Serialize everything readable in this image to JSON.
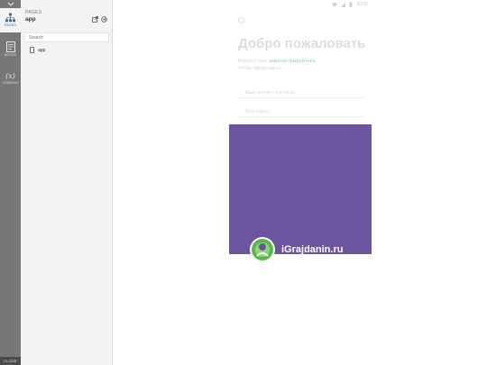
{
  "rail": {
    "items": [
      {
        "label": "PAGES",
        "icon": "sitemap-icon",
        "active": true
      },
      {
        "label": "NOTES",
        "icon": "notes-icon",
        "active": false
      },
      {
        "label": "CONSOLE",
        "icon": "variable-icon",
        "glyph": "(x)",
        "active": false
      }
    ],
    "close_label": "CLOSE"
  },
  "panel": {
    "caption": "PAGES",
    "project": "app",
    "search_placeholder": "Search",
    "pages": [
      {
        "label": "app",
        "icon": "phone-icon"
      }
    ]
  },
  "device": {
    "status_time": "20:01",
    "welcome_title": "Добро пожаловать",
    "subtitle_prefix": "Войдите или",
    "subtitle_link": "зарегистрируйтесь",
    "subtitle_suffix": "чтобы продолжить",
    "field_1_placeholder": "Ваш телефон или email",
    "field_2_placeholder": "Ваш пароль",
    "brand_name": "iGrajdanin.ru"
  },
  "colors": {
    "rail_bg": "#77777a",
    "rail_active_bg": "#f3f3f3",
    "accent": "#3a6f95",
    "splash_bg": "#6b55a1",
    "link_green": "#a8dcc0"
  }
}
